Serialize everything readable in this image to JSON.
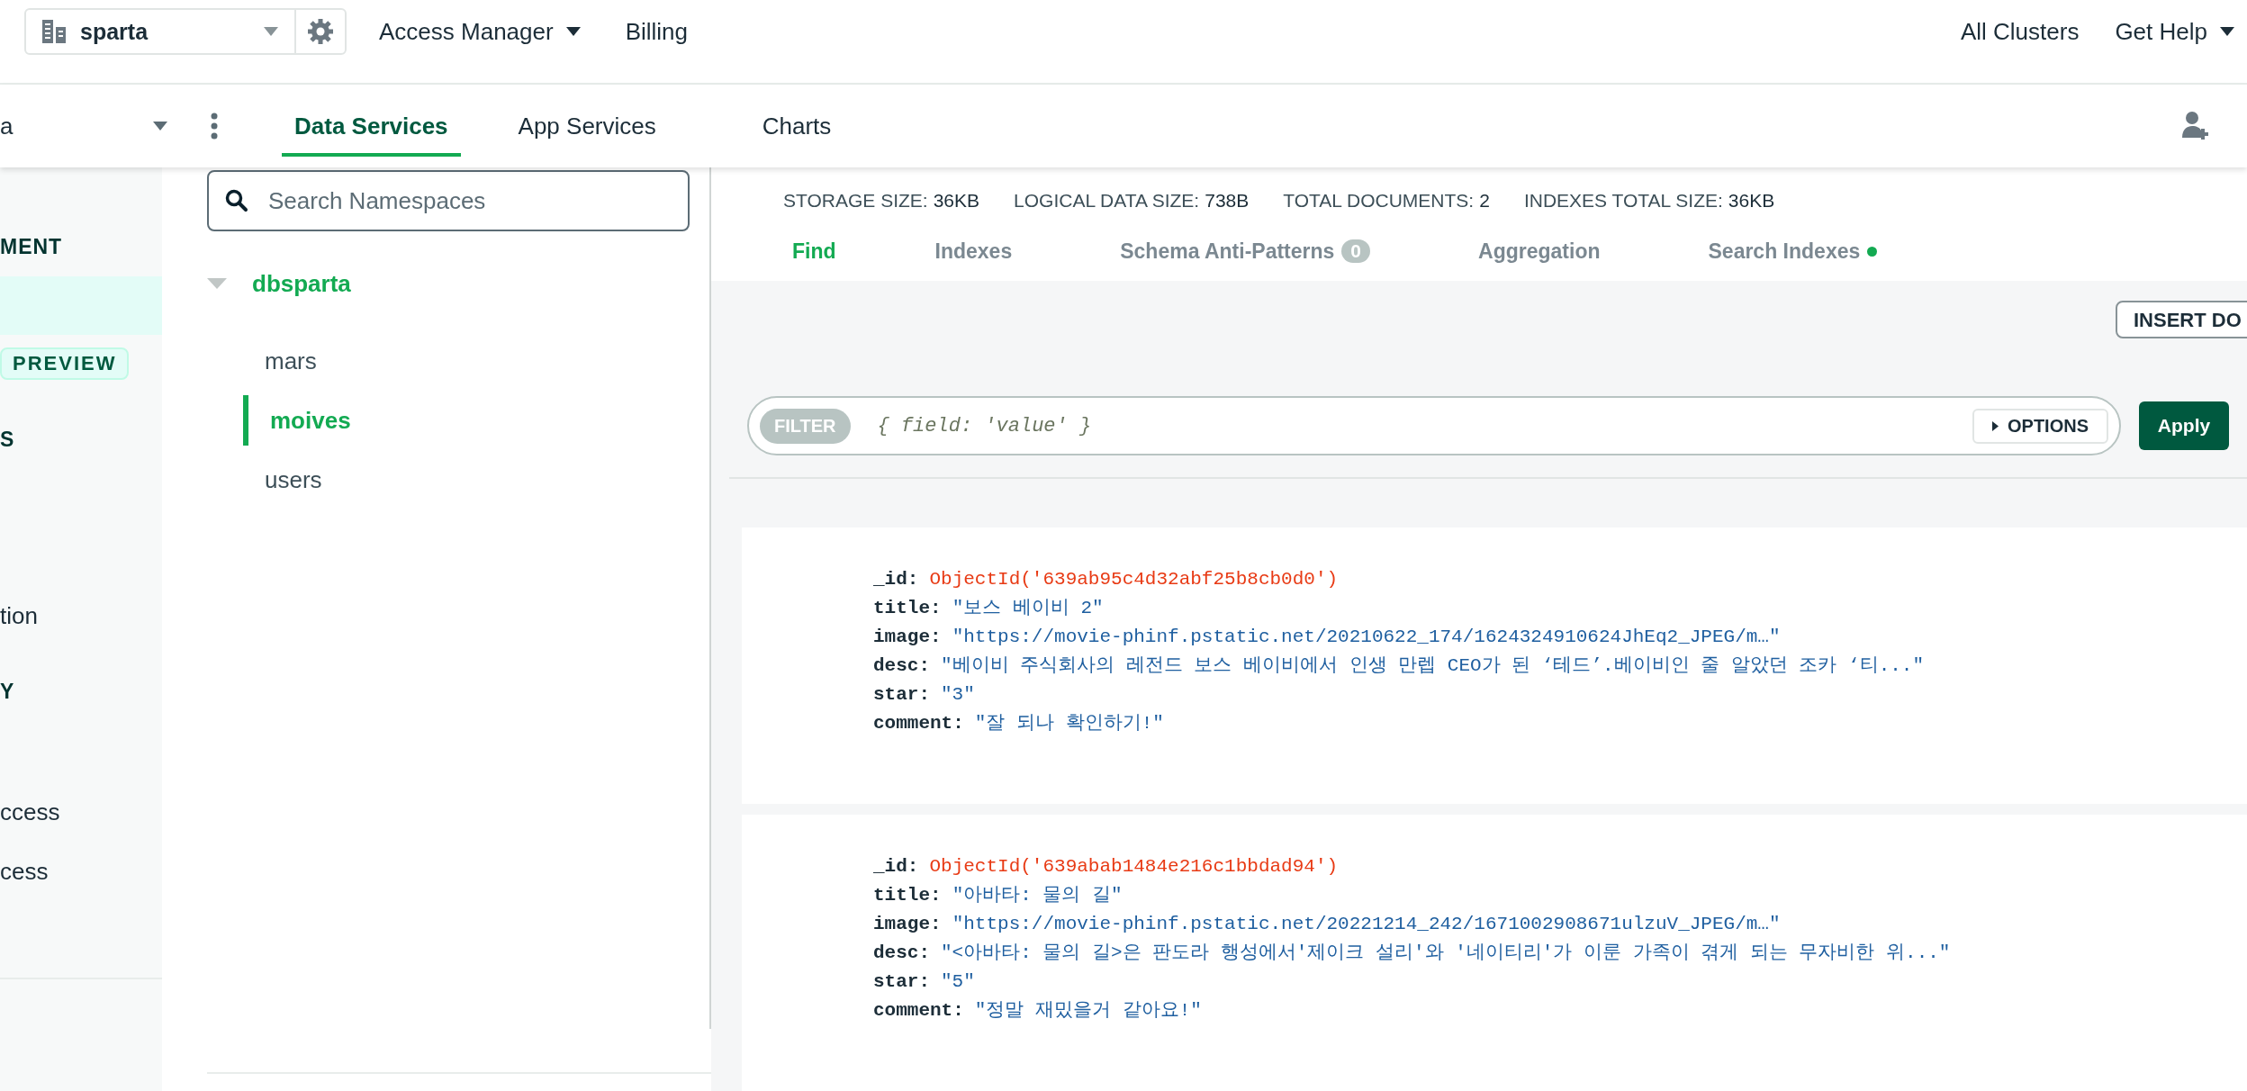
{
  "top_bar": {
    "org": {
      "name": "sparta"
    },
    "menus": [
      {
        "label": "Access Manager",
        "caret": true
      },
      {
        "label": "Billing",
        "caret": false
      }
    ],
    "right_menus": [
      {
        "label": "All Clusters",
        "caret": false
      },
      {
        "label": "Get Help",
        "caret": true
      }
    ]
  },
  "project_bar": {
    "project": "a",
    "tabs": [
      {
        "label": "Data Services",
        "selected": true
      },
      {
        "label": "App Services",
        "selected": false
      },
      {
        "label": "Charts",
        "selected": false
      }
    ]
  },
  "sidebar": {
    "items": [
      {
        "kind": "heading",
        "text": "MENT"
      },
      {
        "kind": "highlight"
      },
      {
        "kind": "badge",
        "text": "PREVIEW"
      },
      {
        "kind": "heading",
        "text": "S"
      },
      {
        "kind": "item",
        "text": "tion"
      },
      {
        "kind": "heading",
        "text": "Y"
      },
      {
        "kind": "item",
        "text": "ccess"
      },
      {
        "kind": "item",
        "text": "cess"
      }
    ]
  },
  "namespaces": {
    "search": {
      "placeholder": "Search Namespaces"
    },
    "databases": [
      {
        "name": "dbsparta",
        "expanded": true,
        "children": [
          {
            "name": "mars",
            "selected": false
          },
          {
            "name": "moives",
            "selected": true
          },
          {
            "name": "users",
            "selected": false
          }
        ]
      }
    ]
  },
  "stats": [
    {
      "label": "STORAGE SIZE:",
      "value": "36KB"
    },
    {
      "label": "LOGICAL DATA SIZE:",
      "value": "738B"
    },
    {
      "label": "TOTAL DOCUMENTS:",
      "value": "2"
    },
    {
      "label": "INDEXES TOTAL SIZE:",
      "value": "36KB"
    }
  ],
  "query_tabs": [
    {
      "label": "Find",
      "selected": true
    },
    {
      "label": "Indexes",
      "selected": false
    },
    {
      "label": "Schema Anti-Patterns",
      "selected": false,
      "badge": "0"
    },
    {
      "label": "Aggregation",
      "selected": false
    },
    {
      "label": "Search Indexes",
      "selected": false,
      "color": "#13aa52"
    }
  ],
  "insert_button": "INSERT DO",
  "filter": {
    "label": "FILTER",
    "placeholder": "{ field: 'value' }",
    "options": "OPTIONS",
    "apply": "Apply"
  },
  "documents": [
    {
      "fields": [
        {
          "key": "_id:",
          "kind": "objectid",
          "value": "ObjectId('639ab95c4d32abf25b8cb0d0')"
        },
        {
          "key": "title:",
          "kind": "string",
          "value": "\"보스 베이비 2\""
        },
        {
          "key": "image:",
          "kind": "string",
          "value": "\"https://movie-phinf.pstatic.net/20210622_174/1624324910624JhEq2_JPEG/m…\""
        },
        {
          "key": "desc:",
          "kind": "string",
          "value": "\"베이비 주식회사의 레전드 보스 베이비에서 인생 만렙 CEO가 된 ‘테드’.베이비인 줄 알았던 조카 ‘티...\""
        },
        {
          "key": "star:",
          "kind": "string",
          "value": "\"3\""
        },
        {
          "key": "comment:",
          "kind": "string",
          "value": "\"잘 되나 확인하기!\""
        }
      ]
    },
    {
      "fields": [
        {
          "key": "_id:",
          "kind": "objectid",
          "value": "ObjectId('639abab1484e216c1bbdad94')"
        },
        {
          "key": "title:",
          "kind": "string",
          "value": "\"아바타: 물의 길\""
        },
        {
          "key": "image:",
          "kind": "string",
          "value": "\"https://movie-phinf.pstatic.net/20221214_242/1671002908671ulzuV_JPEG/m…\""
        },
        {
          "key": "desc:",
          "kind": "string",
          "value": "\"<아바타: 물의 길>은 판도라 행성에서'제이크 설리'와 '네이티리'가 이룬 가족이 겪게 되는 무자비한 위...\""
        },
        {
          "key": "star:",
          "kind": "string",
          "value": "\"5\""
        },
        {
          "key": "comment:",
          "kind": "string",
          "value": "\"정말 재밌을거 같아요!\""
        }
      ]
    }
  ]
}
